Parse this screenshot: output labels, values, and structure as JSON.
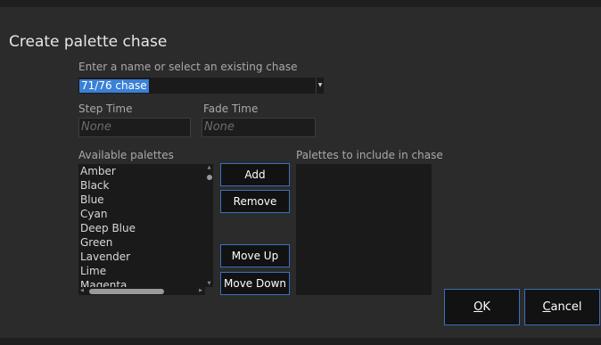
{
  "dialog": {
    "title": "Create palette chase",
    "name_label": "Enter a name or select an existing chase",
    "name_value": "71/76 chase",
    "step_time_label": "Step Time",
    "step_time_placeholder": "None",
    "fade_time_label": "Fade Time",
    "fade_time_placeholder": "None",
    "available_label": "Available palettes",
    "available_items": [
      "Amber",
      "Black",
      "Blue",
      "Cyan",
      "Deep Blue",
      "Green",
      "Lavender",
      "Lime",
      "Magenta"
    ],
    "include_label": "Palettes to include in chase",
    "include_items": []
  },
  "buttons": {
    "add": "Add",
    "remove": "Remove",
    "move_up": "Move Up",
    "move_down": "Move Down",
    "ok_mnemonic": "O",
    "ok_rest": "K",
    "cancel_mnemonic": "C",
    "cancel_rest": "ancel"
  },
  "colors": {
    "background": "#2b2b2b",
    "selection": "#3a80d6",
    "button_border": "#3c6fbe",
    "button_fill": "#121212"
  }
}
